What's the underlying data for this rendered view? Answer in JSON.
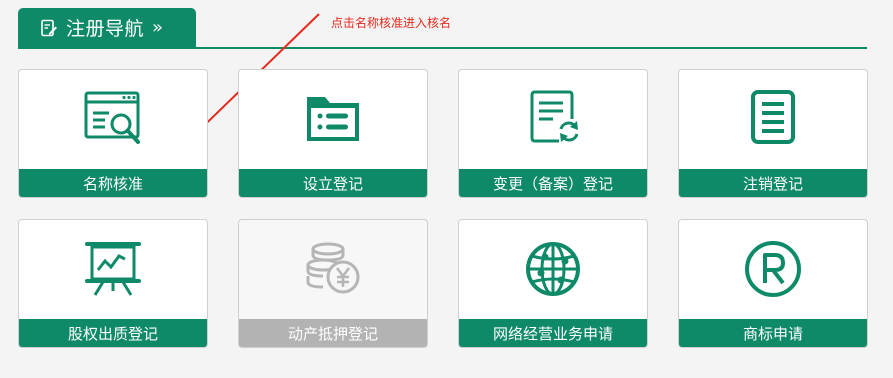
{
  "header": {
    "title": "注册导航",
    "chevron": "»",
    "icon": "edit-document-icon",
    "accent_color": "#0f8a68"
  },
  "annotation": {
    "text": "点击名称核准进入核名",
    "color": "#e6291e"
  },
  "cards": [
    {
      "label": "名称核准",
      "icon": "search-document-icon",
      "enabled": true
    },
    {
      "label": "设立登记",
      "icon": "folder-list-icon",
      "enabled": true
    },
    {
      "label": "变更（备案）登记",
      "icon": "document-refresh-icon",
      "enabled": true
    },
    {
      "label": "注销登记",
      "icon": "document-lines-icon",
      "enabled": true
    },
    {
      "label": "股权出质登记",
      "icon": "presentation-chart-icon",
      "enabled": true
    },
    {
      "label": "动产抵押登记",
      "icon": "coins-yen-icon",
      "enabled": false
    },
    {
      "label": "网络经营业务申请",
      "icon": "globe-network-icon",
      "enabled": true
    },
    {
      "label": "商标申请",
      "icon": "registered-trademark-icon",
      "enabled": true
    }
  ]
}
